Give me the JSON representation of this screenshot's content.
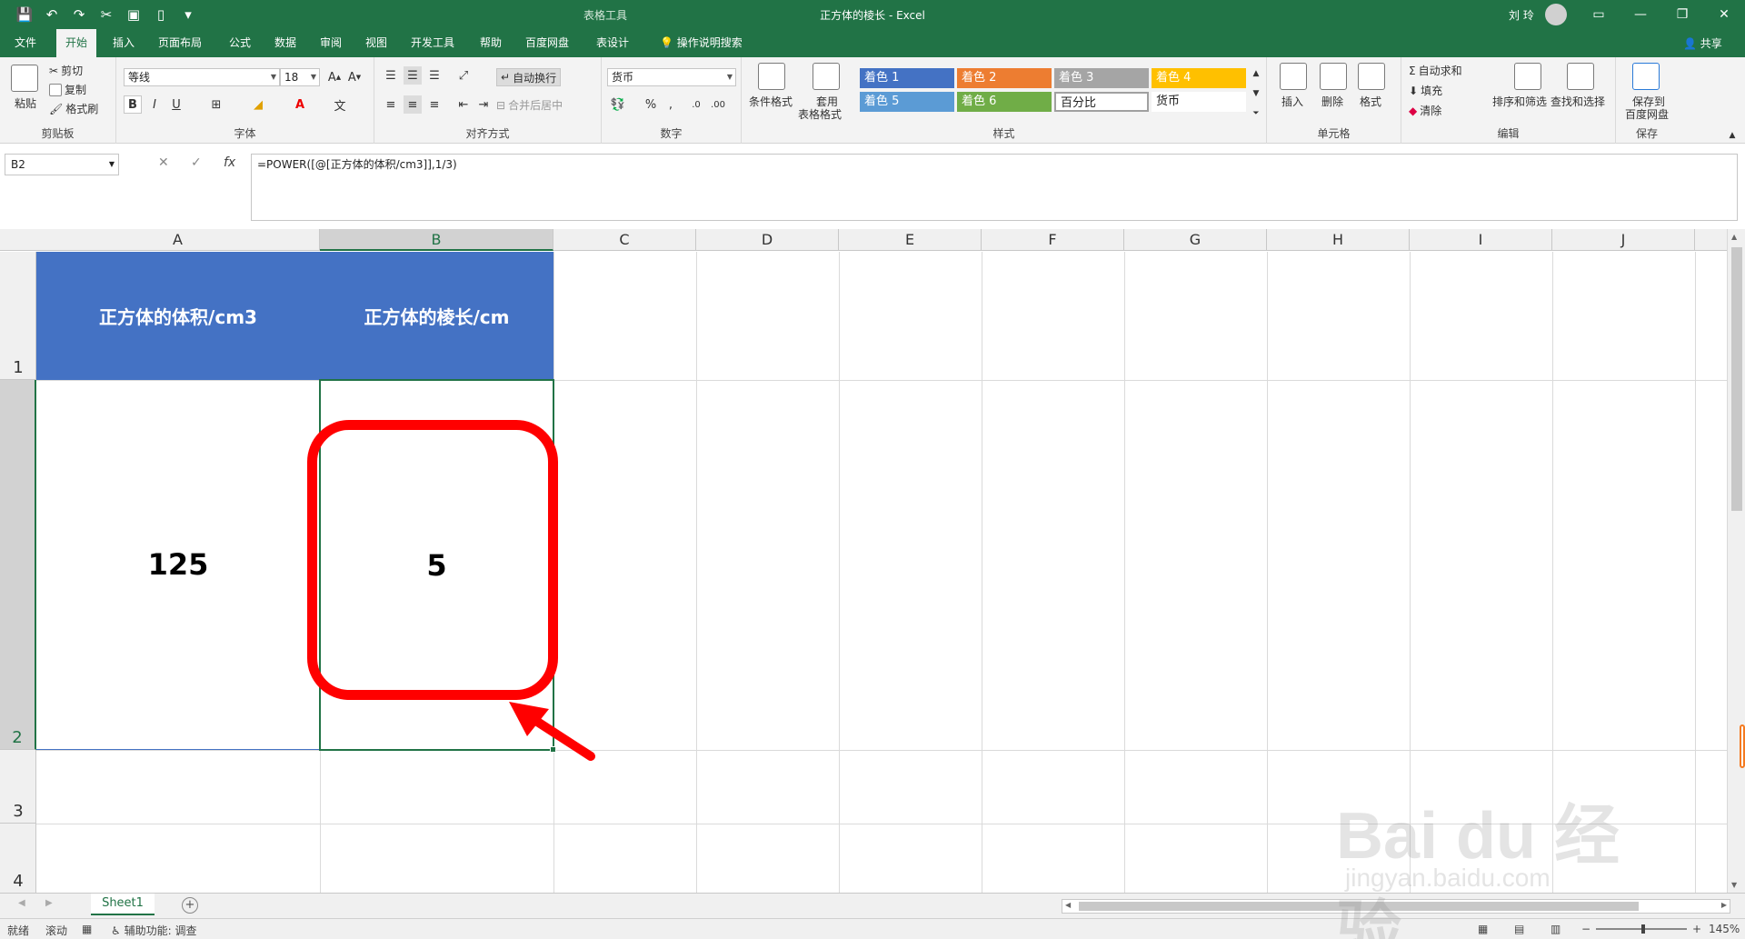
{
  "app": {
    "window_title": "正方体的棱长  -  Excel",
    "context_tab": "表格工具",
    "user_name": "刘 玲"
  },
  "tabs": [
    {
      "label": "文件"
    },
    {
      "label": "开始"
    },
    {
      "label": "插入"
    },
    {
      "label": "页面布局"
    },
    {
      "label": "公式"
    },
    {
      "label": "数据"
    },
    {
      "label": "审阅"
    },
    {
      "label": "视图"
    },
    {
      "label": "开发工具"
    },
    {
      "label": "帮助"
    },
    {
      "label": "百度网盘"
    },
    {
      "label": "表设计"
    },
    {
      "label": "操作说明搜索"
    }
  ],
  "share_label": "共享",
  "ribbon": {
    "clipboard": {
      "paste": "粘贴",
      "cut": "剪切",
      "copy": "复制",
      "format_painter": "格式刷",
      "label": "剪贴板"
    },
    "font": {
      "name": "等线",
      "size": "18",
      "label": "字体",
      "bold": "B",
      "italic": "I",
      "underline": "U"
    },
    "alignment": {
      "wrap": "自动换行",
      "merge": "合并后居中",
      "label": "对齐方式"
    },
    "number": {
      "format": "货币",
      "label": "数字",
      "percent": "%",
      "comma": ","
    },
    "styles": {
      "conditional": "条件格式",
      "table_format_1": "套用",
      "table_format_2": "表格格式",
      "cells": [
        "着色 1",
        "着色 2",
        "着色 3",
        "着色 4",
        "着色 5",
        "着色 6",
        "百分比",
        "货币"
      ],
      "label": "样式"
    },
    "cells_group": {
      "insert": "插入",
      "delete": "删除",
      "format": "格式",
      "label": "单元格"
    },
    "editing": {
      "autosum": "自动求和",
      "fill": "填充",
      "clear": "清除",
      "sort": "排序和筛选",
      "find": "查找和选择",
      "label": "编辑"
    },
    "save": {
      "line1": "保存到",
      "line2": "百度网盘",
      "label": "保存"
    }
  },
  "formula_bar": {
    "name_box": "B2",
    "cancel": "✕",
    "enter": "✓",
    "fx": "fx",
    "formula": "=POWER([@[正方体的体积/cm3]],1/3)"
  },
  "grid": {
    "columns": [
      "A",
      "B",
      "C",
      "D",
      "E",
      "F",
      "G",
      "H",
      "I",
      "J"
    ],
    "rows": [
      "1",
      "2",
      "3",
      "4"
    ],
    "selected_cell": "B2",
    "cells": {
      "A1": "正方体的体积/cm3",
      "B1": "正方体的棱长/cm",
      "A2": "125",
      "B2": "5"
    }
  },
  "sheets": [
    {
      "name": "Sheet1",
      "active": true
    }
  ],
  "status": {
    "ready": "就绪",
    "scroll": "滚动",
    "accessibility": "辅助功能: 调查",
    "zoom": "145%"
  },
  "watermark": {
    "brand": "Bai du 经验",
    "url": "jingyan.baidu.com"
  },
  "colors": {
    "excel_green": "#217346",
    "header_fill": "#4472c4",
    "annotation_red": "#ff0000",
    "accent1": "#4472c4",
    "accent2": "#ed7d31",
    "accent3": "#a5a5a5",
    "accent4": "#ffc000",
    "accent5": "#5b9bd5",
    "accent6": "#70ad47"
  }
}
